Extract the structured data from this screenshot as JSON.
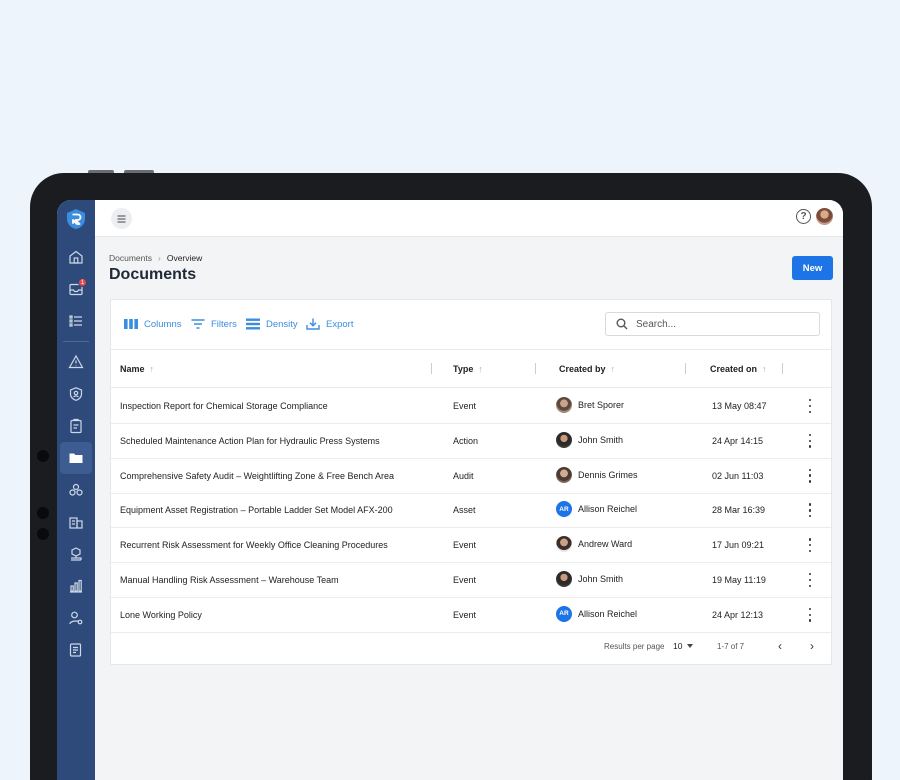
{
  "app": {
    "has_notifications": "1"
  },
  "breadcrumb": {
    "root": "Documents",
    "separator": "›",
    "current": "Overview"
  },
  "page": {
    "title": "Documents",
    "new_label": "New"
  },
  "toolbar": {
    "columns": "Columns",
    "filters": "Filters",
    "density": "Density",
    "export": "Export",
    "search_placeholder": "Search..."
  },
  "table": {
    "headers": {
      "name": "Name",
      "type": "Type",
      "created_by": "Created by",
      "created_on": "Created on",
      "sort_arrow": "↑"
    },
    "rows": [
      {
        "name": "Inspection Report for Chemical Storage Compliance",
        "type": "Event",
        "user": "Bret Sporer",
        "initials": "",
        "date": "13 May 08:47"
      },
      {
        "name": "Scheduled Maintenance Action Plan for Hydraulic Press Systems",
        "type": "Action",
        "user": "John Smith",
        "initials": "",
        "date": "24 Apr 14:15"
      },
      {
        "name": "Comprehensive Safety Audit – Weightlifting Zone & Free Bench Area",
        "type": "Audit",
        "user": "Dennis Grimes",
        "initials": "",
        "date": "02 Jun 11:03"
      },
      {
        "name": "Equipment Asset Registration – Portable Ladder Set Model AFX-200",
        "type": "Asset",
        "user": "Allison Reichel",
        "initials": "AR",
        "date": "28 Mar 16:39"
      },
      {
        "name": "Recurrent Risk Assessment for Weekly Office Cleaning Procedures",
        "type": "Event",
        "user": "Andrew Ward",
        "initials": "",
        "date": "17 Jun 09:21"
      },
      {
        "name": "Manual Handling Risk Assessment – Warehouse Team",
        "type": "Event",
        "user": "John Smith",
        "initials": "",
        "date": "19 May 11:19"
      },
      {
        "name": "Lone Working Policy",
        "type": "Event",
        "user": "Allison Reichel",
        "initials": "AR",
        "date": "24 Apr 12:13"
      }
    ]
  },
  "footer": {
    "results_label": "Results per page",
    "per_page": "10",
    "range": "1-7 of 7",
    "prev": "‹",
    "next": "›"
  },
  "colors": {
    "sidebar": "#2d4a7a",
    "accent": "#1c74e6",
    "tool": "#3b8de0"
  },
  "icons": [
    "home-icon",
    "inbox-icon",
    "list-icon",
    "warning-icon",
    "shield-icon",
    "clipboard-icon",
    "folder-icon",
    "modules-icon",
    "building-icon",
    "hierarchy-icon",
    "chart-icon",
    "user-settings-icon",
    "report-icon"
  ]
}
